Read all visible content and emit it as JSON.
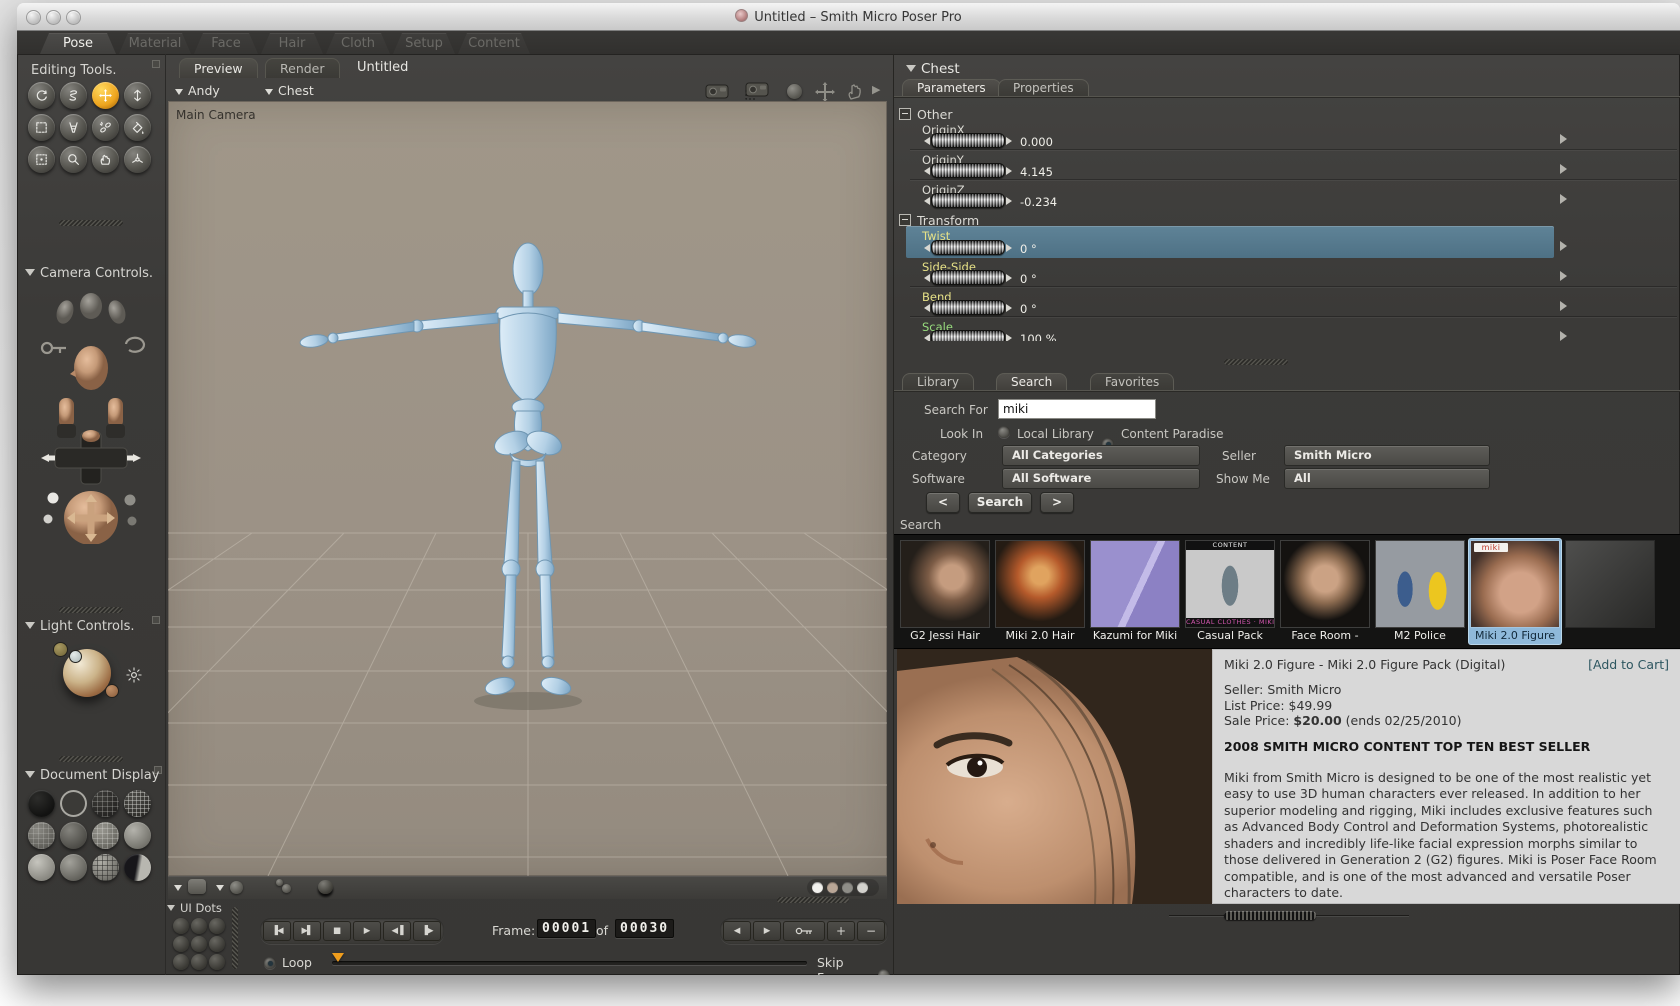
{
  "window": {
    "title": "Untitled – Smith Micro Poser Pro"
  },
  "room_tabs": [
    "Pose",
    "Material",
    "Face",
    "Hair",
    "Cloth",
    "Setup",
    "Content"
  ],
  "sidebar": {
    "editing_tools_title": "Editing Tools.",
    "tools": [
      "rotate",
      "twist",
      "translate-pull",
      "translate-in-out",
      "scale",
      "taper",
      "chain-break",
      "color",
      "grouping",
      "view-magnifier",
      "morphing-tool",
      "direct-manipulation"
    ],
    "active_tool": "translate-pull",
    "camera_controls_title": "Camera Controls.",
    "light_controls_title": "Light Controls.",
    "document_display_title": "Document Display",
    "ui_dots_title": "UI Dots"
  },
  "document": {
    "tab_preview": "Preview",
    "tab_render": "Render",
    "title": "Untitled",
    "figure_menu": "Andy",
    "actor_menu": "Chest",
    "camera_label": "Main Camera"
  },
  "playback": {
    "frame_label": "Frame:",
    "current_frame": "00001",
    "of_label": "of",
    "total_frames": "00030",
    "loop_label": "Loop",
    "skip_frames_label": "Skip Frames"
  },
  "parameters": {
    "header": "Chest",
    "tab_parameters": "Parameters",
    "tab_properties": "Properties",
    "group_other": "Other",
    "group_transform": "Transform",
    "dials": [
      {
        "label": "OriginX",
        "value": "0.000"
      },
      {
        "label": "OriginY",
        "value": "4.145"
      },
      {
        "label": "OriginZ",
        "value": "-0.234"
      },
      {
        "label": "Twist",
        "value": "0 °",
        "selected": true
      },
      {
        "label": "Side-Side",
        "value": "0 °"
      },
      {
        "label": "Bend",
        "value": "0 °"
      },
      {
        "label": "Scale",
        "value": "100 %"
      }
    ]
  },
  "library": {
    "tab_library": "Library",
    "tab_search": "Search",
    "tab_favorites": "Favorites",
    "search_for_label": "Search For",
    "search_value": "miki",
    "look_in_label": "Look In",
    "radio_local": "Local Library",
    "radio_paradise": "Content Paradise",
    "category_label": "Category",
    "category_value": "All Categories",
    "seller_label": "Seller",
    "seller_value": "Smith Micro",
    "software_label": "Software",
    "software_value": "All Software",
    "show_me_label": "Show Me",
    "show_me_value": "All",
    "prev_button": "<",
    "search_button": "Search",
    "next_button": ">",
    "results_section_label": "Search",
    "results": [
      {
        "label": "G2 Jessi Hair"
      },
      {
        "label": "Miki 2.0 Hair"
      },
      {
        "label": "Kazumi for Miki"
      },
      {
        "label": "Casual Pack",
        "overlay_top": "CONTENT",
        "overlay_bottom": "CASUAL CLOTHES · MIKI"
      },
      {
        "label": "Face Room -"
      },
      {
        "label": "M2 Police"
      },
      {
        "label": "Miki 2.0 Figure",
        "overlay_top": "miki",
        "selected": true
      }
    ]
  },
  "product": {
    "title": "Miki 2.0 Figure - Miki 2.0 Figure Pack (Digital)",
    "add_to_cart": "[Add to Cart]",
    "seller": "Seller: Smith Micro",
    "list_price": "List Price: $49.99",
    "sale_price_prefix": "Sale Price: ",
    "sale_price": "$20.00",
    "sale_price_suffix": " (ends 02/25/2010)",
    "banner": "2008 SMITH MICRO CONTENT TOP TEN BEST SELLER",
    "description": "Miki from Smith Micro is designed to be one of the most realistic yet easy to use 3D human characters ever released. In addition to her superior modeling and rigging, Miki includes exclusive features such as Advanced Body Control and Deformation Systems, photorealistic shaders and incredibly life-like facial expression morphs similar to those delivered in Generation 2 (G2) figures. Miki is Poser Face Room compatible, and is one of the most advanced and versatile Poser characters to date."
  },
  "colors": {
    "accent_orange": "#eda41e",
    "selection_blue": "#537689",
    "param_yellow": "#e6e187",
    "param_green": "#97db7d",
    "viewport_bg": "#9c9286",
    "figure_blue": "#aecfe6",
    "result_selected": "#8fb9da"
  }
}
